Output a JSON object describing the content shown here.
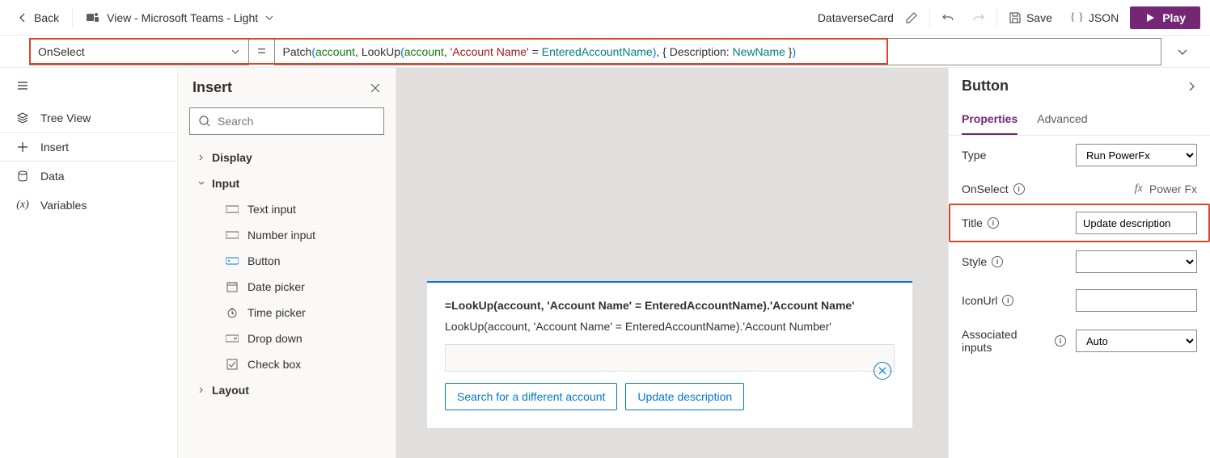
{
  "topbar": {
    "back_label": "Back",
    "view_label": "View - Microsoft Teams - Light",
    "card_name": "DataverseCard",
    "save_label": "Save",
    "json_label": "JSON",
    "play_label": "Play"
  },
  "formula": {
    "property": "OnSelect",
    "tokens": [
      {
        "t": "fn",
        "v": "Patch"
      },
      {
        "t": "par",
        "v": "("
      },
      {
        "t": "id",
        "v": "account"
      },
      {
        "t": "op",
        "v": ", "
      },
      {
        "t": "fn",
        "v": "LookUp"
      },
      {
        "t": "par",
        "v": "("
      },
      {
        "t": "id",
        "v": "account"
      },
      {
        "t": "op",
        "v": ", "
      },
      {
        "t": "str",
        "v": "'Account Name'"
      },
      {
        "t": "op",
        "v": " = "
      },
      {
        "t": "var",
        "v": "EnteredAccountName"
      },
      {
        "t": "par",
        "v": ")"
      },
      {
        "t": "op",
        "v": ", { "
      },
      {
        "t": "fn",
        "v": "Description"
      },
      {
        "t": "op",
        "v": ": "
      },
      {
        "t": "var",
        "v": "NewName"
      },
      {
        "t": "op",
        "v": " }"
      },
      {
        "t": "par",
        "v": ")"
      }
    ]
  },
  "leftnav": {
    "items": [
      {
        "icon": "layers",
        "label": "Tree View"
      },
      {
        "icon": "plus",
        "label": "Insert"
      },
      {
        "icon": "db",
        "label": "Data"
      },
      {
        "icon": "var",
        "label": "Variables"
      }
    ]
  },
  "insert": {
    "title": "Insert",
    "search_placeholder": "Search",
    "categories": [
      {
        "label": "Display",
        "open": false
      },
      {
        "label": "Input",
        "open": true,
        "items": [
          {
            "icon": "text",
            "label": "Text input"
          },
          {
            "icon": "number",
            "label": "Number input"
          },
          {
            "icon": "button",
            "label": "Button"
          },
          {
            "icon": "date",
            "label": "Date picker"
          },
          {
            "icon": "time",
            "label": "Time picker"
          },
          {
            "icon": "dropdown",
            "label": "Drop down"
          },
          {
            "icon": "checkbox",
            "label": "Check box"
          }
        ]
      },
      {
        "label": "Layout",
        "open": false
      }
    ]
  },
  "canvas": {
    "line1": "=LookUp(account, 'Account Name' = EnteredAccountName).'Account Name'",
    "line2": "LookUp(account, 'Account Name' = EnteredAccountName).'Account Number'",
    "btn1": "Search for a different account",
    "btn2": "Update description"
  },
  "rightpane": {
    "title": "Button",
    "tabs": [
      "Properties",
      "Advanced"
    ],
    "props": {
      "type_label": "Type",
      "type_value": "Run PowerFx",
      "onselect_label": "OnSelect",
      "onselect_value": "Power Fx",
      "title_label": "Title",
      "title_value": "Update description",
      "style_label": "Style",
      "style_value": "",
      "iconurl_label": "IconUrl",
      "iconurl_value": "",
      "assoc_label": "Associated inputs",
      "assoc_value": "Auto"
    }
  }
}
